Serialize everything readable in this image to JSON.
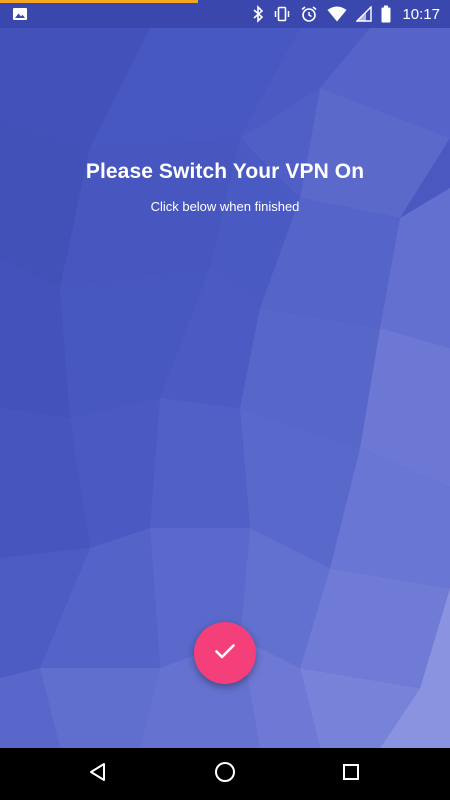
{
  "status_bar": {
    "time": "10:17",
    "progress_percent": 44,
    "progress_color": "#f5a623",
    "left_icon": "image-notification-icon",
    "right_icons": [
      "bluetooth-icon",
      "vibrate-icon",
      "alarm-icon",
      "wifi-icon",
      "signal-icon",
      "battery-icon"
    ]
  },
  "main": {
    "title": "Please Switch Your VPN On",
    "subtitle": "Click below when finished"
  },
  "fab": {
    "icon": "check-icon",
    "color": "#f43f7a"
  },
  "colors": {
    "background": "#4a58c0",
    "status_bar": "#3a48ad"
  },
  "nav_bar": {
    "buttons": [
      "back-icon",
      "home-icon",
      "recents-icon"
    ]
  }
}
